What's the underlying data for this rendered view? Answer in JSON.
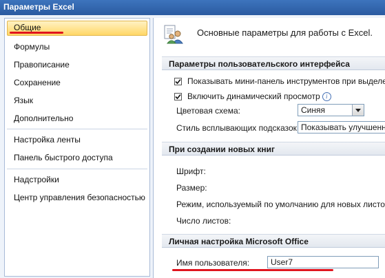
{
  "window": {
    "title": "Параметры Excel"
  },
  "sidebar": {
    "items": [
      {
        "label": "Общие",
        "active": true
      },
      {
        "label": "Формулы"
      },
      {
        "label": "Правописание"
      },
      {
        "label": "Сохранение"
      },
      {
        "label": "Язык"
      },
      {
        "label": "Дополнительно"
      },
      {
        "label": "Настройка ленты"
      },
      {
        "label": "Панель быстрого доступа"
      },
      {
        "label": "Надстройки"
      },
      {
        "label": "Центр управления безопасностью"
      }
    ]
  },
  "main": {
    "header": "Основные параметры для работы с Excel.",
    "ui_section": {
      "title": "Параметры пользовательского интерфейса",
      "mini_toolbar": {
        "label": "Показывать мини-панель инструментов при выделении",
        "checked": true
      },
      "live_preview": {
        "label": "Включить динамический просмотр",
        "checked": true
      },
      "color_scheme": {
        "label": "Цветовая схема:",
        "value": "Синяя"
      },
      "tooltip_style": {
        "label": "Стиль всплывающих подсказок:",
        "value": "Показывать улучшенные всплывающие подсказки"
      }
    },
    "new_book_section": {
      "title": "При создании новых книг",
      "font_label": "Шрифт:",
      "size_label": "Размер:",
      "view_label": "Режим, используемый по умолчанию для новых листов:",
      "sheets_label": "Число листов:"
    },
    "personal_section": {
      "title": "Личная настройка Microsoft Office",
      "username_label": "Имя пользователя:",
      "username_value": "User7"
    }
  },
  "colors": {
    "title_bar": "#2a5aa0",
    "active_item": "#ffd767",
    "annotation_underline": "#e0141e"
  }
}
